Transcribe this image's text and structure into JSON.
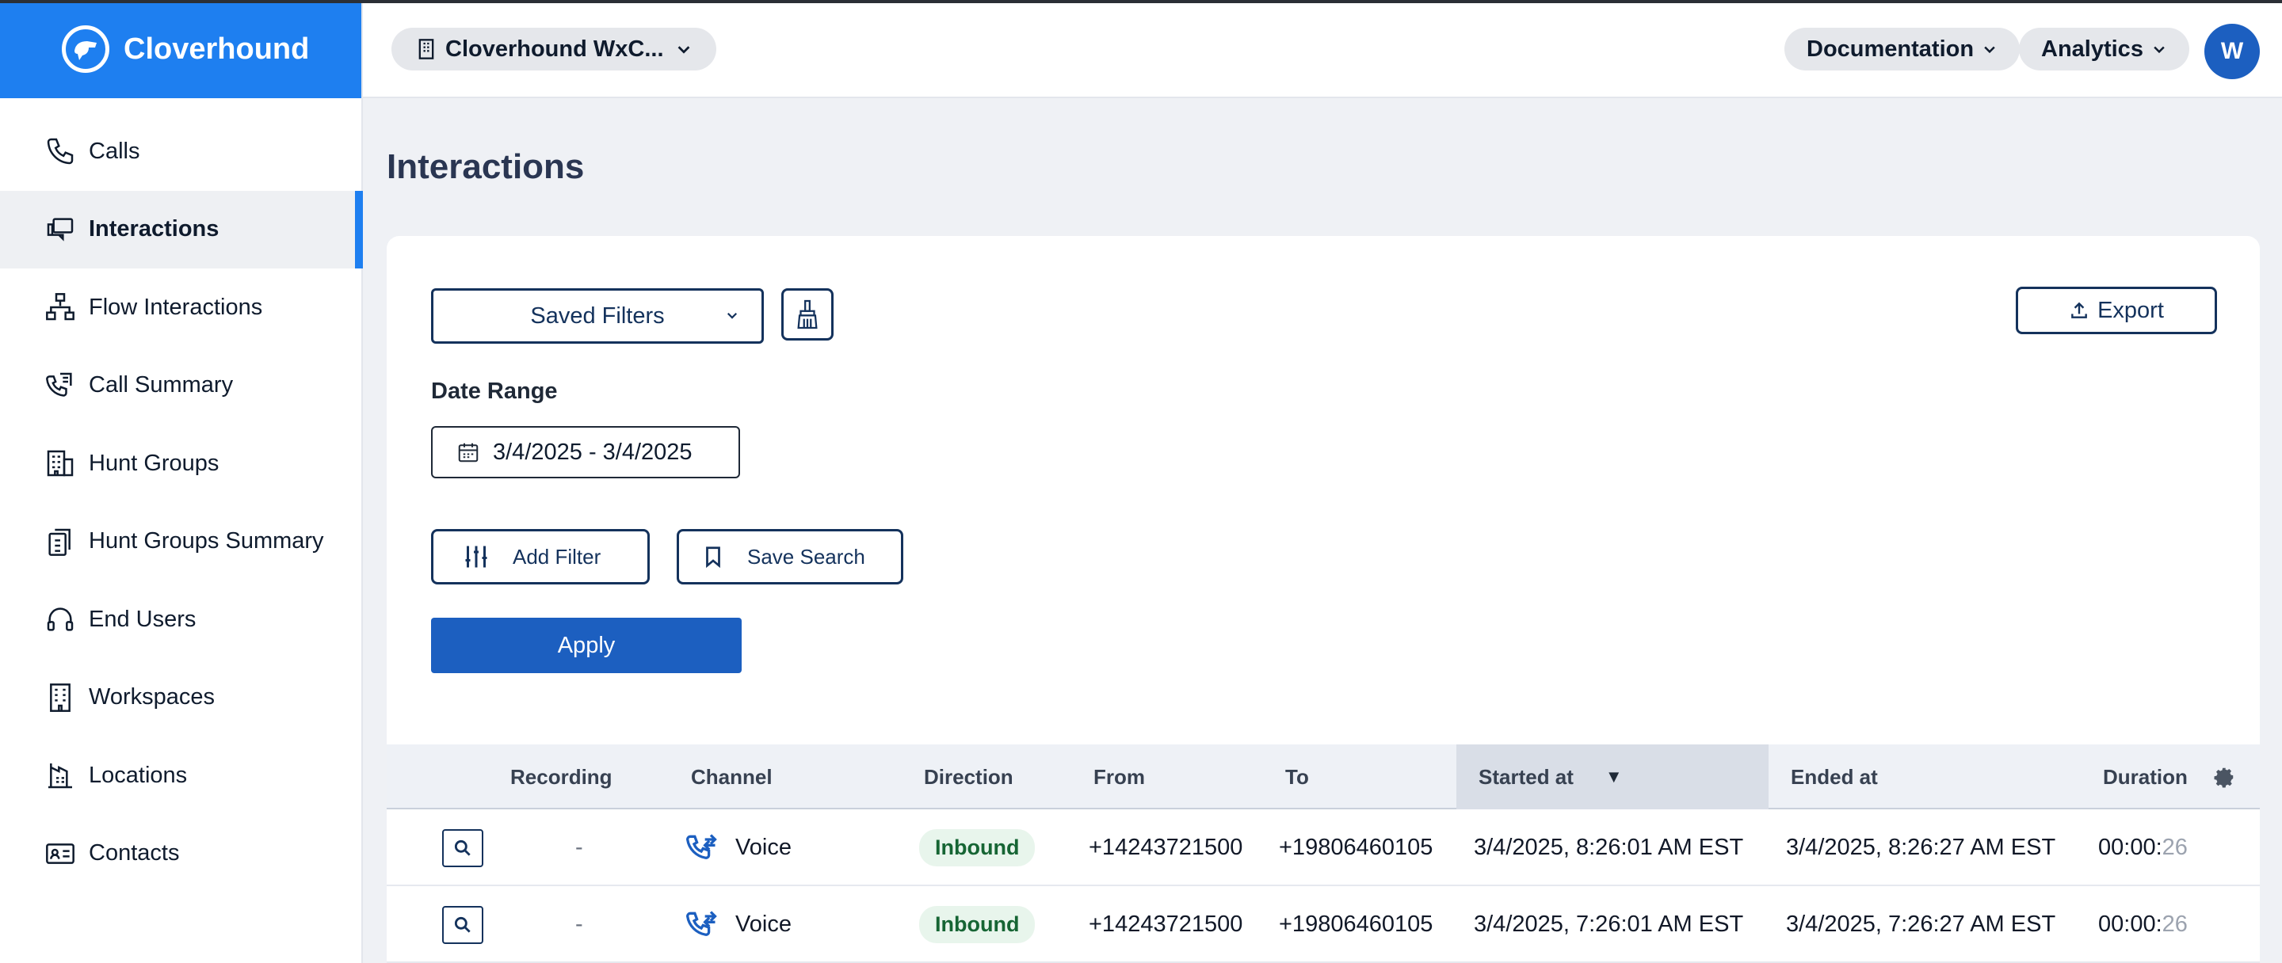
{
  "brand": {
    "name": "Cloverhound"
  },
  "header": {
    "org": "Cloverhound WxC...",
    "docs": "Documentation",
    "analytics": "Analytics",
    "avatar": "W"
  },
  "sidebar": {
    "items": [
      {
        "label": "Calls",
        "icon": "phone-icon"
      },
      {
        "label": "Interactions",
        "icon": "chat-icon",
        "active": true
      },
      {
        "label": "Flow Interactions",
        "icon": "flow-icon"
      },
      {
        "label": "Call Summary",
        "icon": "call-summary-icon"
      },
      {
        "label": "Hunt Groups",
        "icon": "building-icon"
      },
      {
        "label": "Hunt Groups Summary",
        "icon": "clipboard-icon"
      },
      {
        "label": "End Users",
        "icon": "headset-icon"
      },
      {
        "label": "Workspaces",
        "icon": "office-icon"
      },
      {
        "label": "Locations",
        "icon": "location-icon"
      },
      {
        "label": "Contacts",
        "icon": "contact-card-icon"
      }
    ]
  },
  "page": {
    "title": "Interactions"
  },
  "filters": {
    "saved_filters": "Saved Filters",
    "export": "Export",
    "date_label": "Date Range",
    "date_value": "3/4/2025 - 3/4/2025",
    "add_filter": "Add Filter",
    "save_search": "Save Search",
    "apply": "Apply"
  },
  "table": {
    "columns": [
      "Recording",
      "Channel",
      "Direction",
      "From",
      "To",
      "Started at",
      "Ended at",
      "Duration"
    ],
    "rows": [
      {
        "recording": "-",
        "channel": "Voice",
        "direction": "Inbound",
        "from": "+14243721500",
        "to": "+19806460105",
        "started": "3/4/2025, 8:26:01 AM EST",
        "ended": "3/4/2025, 8:26:27 AM EST",
        "duration_a": "00:00:",
        "duration_b": "26"
      },
      {
        "recording": "-",
        "channel": "Voice",
        "direction": "Inbound",
        "from": "+14243721500",
        "to": "+19806460105",
        "started": "3/4/2025, 7:26:01 AM EST",
        "ended": "3/4/2025, 7:26:27 AM EST",
        "duration_a": "00:00:",
        "duration_b": "26"
      }
    ]
  },
  "colors": {
    "brand": "#1e7ff0",
    "primary": "#1c5fc0",
    "navy": "#14325c"
  }
}
